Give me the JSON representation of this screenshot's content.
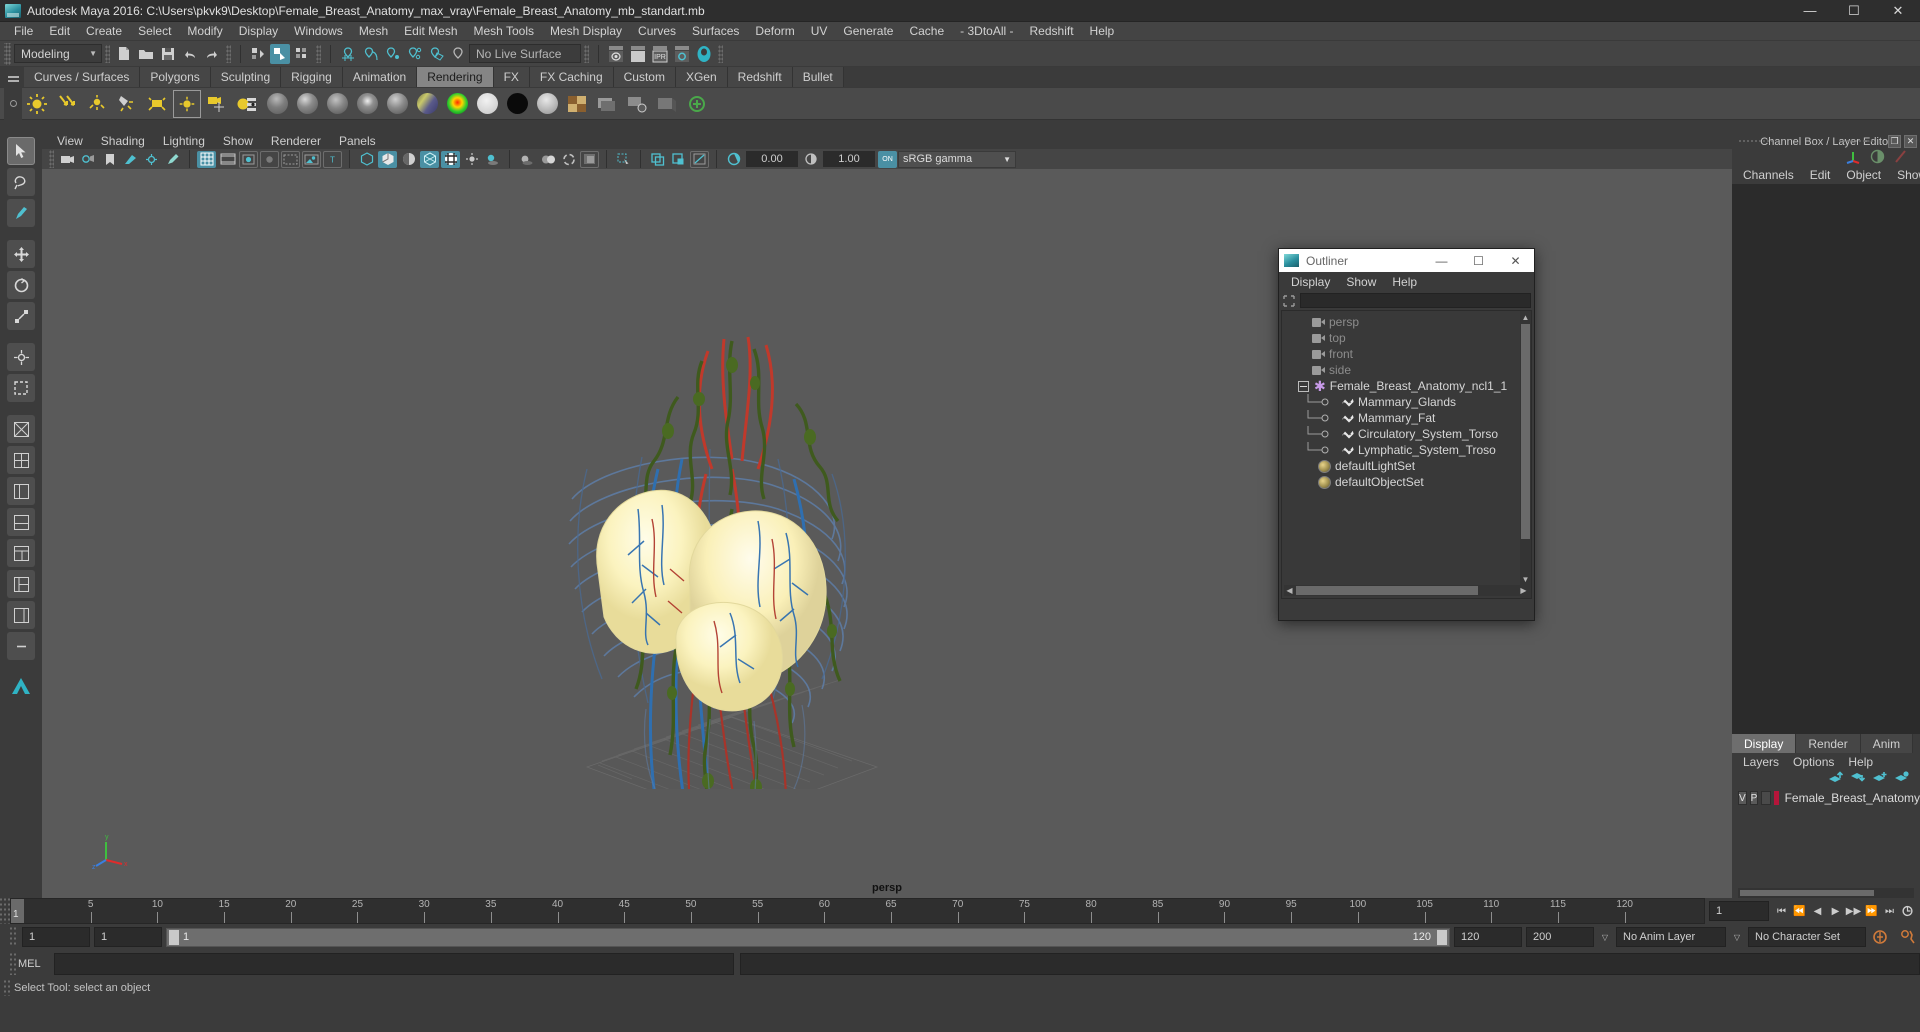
{
  "window": {
    "title": "Autodesk Maya 2016: C:\\Users\\pkvk9\\Desktop\\Female_Breast_Anatomy_max_vray\\Female_Breast_Anatomy_mb_standart.mb",
    "minimize": "—",
    "maximize": "☐",
    "close": "✕"
  },
  "menubar": {
    "items": [
      "File",
      "Edit",
      "Create",
      "Select",
      "Modify",
      "Display",
      "Windows",
      "Mesh",
      "Edit Mesh",
      "Mesh Tools",
      "Mesh Display",
      "Curves",
      "Surfaces",
      "Deform",
      "UV",
      "Generate",
      "Cache",
      "- 3DtoAll -",
      "Redshift",
      "Help"
    ]
  },
  "toolbar": {
    "menu_set": "Modeling",
    "menu_set_arrow": "▼",
    "live_surface": "No Live Surface",
    "ipr_label": "IPR"
  },
  "shelf": {
    "tabs": [
      "Curves / Surfaces",
      "Polygons",
      "Sculpting",
      "Rigging",
      "Animation",
      "Rendering",
      "FX",
      "FX Caching",
      "Custom",
      "XGen",
      "Redshift",
      "Bullet"
    ],
    "active_tab": "Rendering"
  },
  "viewport": {
    "menus": [
      "View",
      "Shading",
      "Lighting",
      "Show",
      "Renderer",
      "Panels"
    ],
    "exposure": "0.00",
    "gamma": "1.00",
    "view_transform": "sRGB gamma",
    "view_transform_arrow": "▼",
    "toggle_on_label": "ON",
    "camera_label": "persp",
    "axis_x": "x",
    "axis_y": "y",
    "axis_z": "z"
  },
  "outliner": {
    "title": "Outliner",
    "minimize": "—",
    "maximize": "☐",
    "close": "✕",
    "menus": [
      "Display",
      "Show",
      "Help"
    ],
    "search_value": "",
    "tree": [
      {
        "label": "persp",
        "type": "camera",
        "depth": 1,
        "dim": true
      },
      {
        "label": "top",
        "type": "camera",
        "depth": 1,
        "dim": true
      },
      {
        "label": "front",
        "type": "camera",
        "depth": 1,
        "dim": true
      },
      {
        "label": "side",
        "type": "camera",
        "depth": 1,
        "dim": true
      },
      {
        "label": "Female_Breast_Anatomy_ncl1_1",
        "type": "group",
        "depth": 0,
        "dim": false,
        "expanded": true
      },
      {
        "label": "Mammary_Glands",
        "type": "mesh",
        "depth": 2,
        "dim": false
      },
      {
        "label": "Mammary_Fat",
        "type": "mesh",
        "depth": 2,
        "dim": false
      },
      {
        "label": "Circulatory_System_Torso",
        "type": "mesh",
        "depth": 2,
        "dim": false
      },
      {
        "label": "Lymphatic_System_Troso",
        "type": "mesh",
        "depth": 2,
        "dim": false
      },
      {
        "label": "defaultLightSet",
        "type": "set",
        "depth": 1,
        "dim": false
      },
      {
        "label": "defaultObjectSet",
        "type": "set",
        "depth": 1,
        "dim": false
      }
    ]
  },
  "channel_box": {
    "title": "Channel Box / Layer Editor",
    "menus": [
      "Channels",
      "Edit",
      "Object",
      "Show"
    ],
    "restore": "❐",
    "close": "✕"
  },
  "layer_editor": {
    "tabs": [
      "Display",
      "Render",
      "Anim"
    ],
    "active_tab": "Display",
    "menus": [
      "Layers",
      "Options",
      "Help"
    ],
    "layers": [
      {
        "visibility": "V",
        "playback": "P",
        "color": "#b5153a",
        "name": "Female_Breast_Anatomy"
      }
    ]
  },
  "timeline": {
    "current_frame": "1",
    "current_frame_field": "1",
    "ticks": [
      5,
      10,
      15,
      20,
      25,
      30,
      35,
      40,
      45,
      50,
      55,
      60,
      65,
      70,
      75,
      80,
      85,
      90,
      95,
      100,
      105,
      110,
      115,
      120
    ],
    "playback_buttons": [
      "⏮",
      "⏪",
      "◀",
      "▶",
      "▶▶",
      "⏩",
      "⏭"
    ],
    "range_start": "1",
    "range_start2": "1",
    "range_bar_left": "1",
    "range_bar_right": "120",
    "range_end": "120",
    "playback_end": "200",
    "anim_layer": "No Anim Layer",
    "character_set": "No Character Set",
    "dropdown_arrow": "▽"
  },
  "command_line": {
    "language": "MEL",
    "command_value": "",
    "output_value": ""
  },
  "status": {
    "message": "Select Tool: select an object"
  },
  "colors": {
    "accent": "#4a90a4",
    "layer_swatch": "#b5153a",
    "viewport_bg": "#5a5a5a"
  }
}
